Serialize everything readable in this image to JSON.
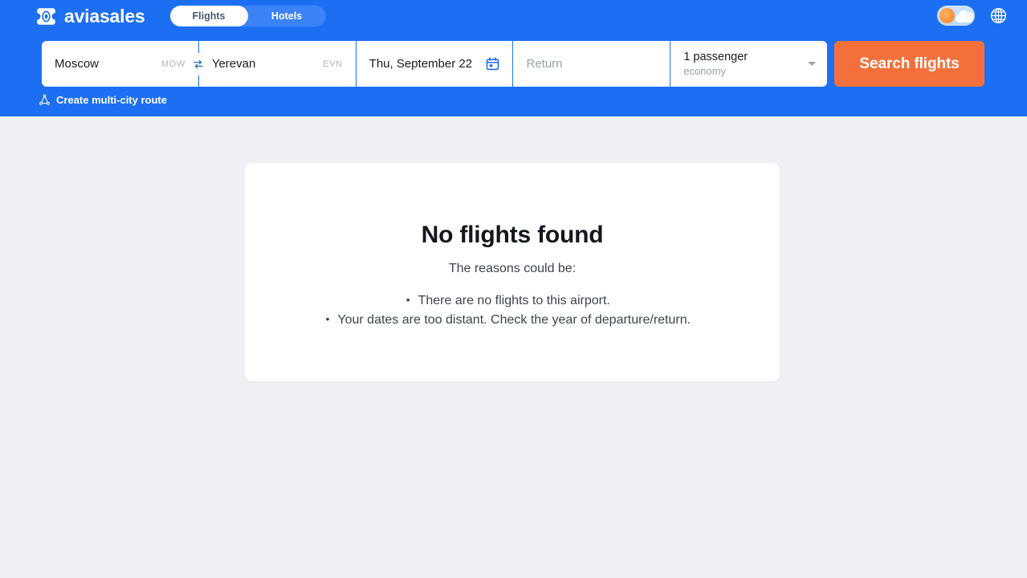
{
  "brand": {
    "name": "aviasales",
    "logo_icon": "aviasales-logo-icon"
  },
  "tabs": [
    {
      "label": "Flights",
      "active": true
    },
    {
      "label": "Hotels",
      "active": false
    }
  ],
  "topbar_right": {
    "theme_toggle_icon": "sun-cloud-toggle-icon",
    "language_icon": "globe-icon"
  },
  "search_form": {
    "origin": {
      "value": "Moscow",
      "code": "MOW"
    },
    "destination": {
      "value": "Yerevan",
      "code": "EVN"
    },
    "swap_icon": "swap-arrows-icon",
    "depart": {
      "value": "Thu, September 22",
      "icon": "calendar-icon"
    },
    "return": {
      "placeholder": "Return",
      "value": ""
    },
    "passengers": {
      "count_label": "1 passenger",
      "class_label": "economy",
      "caret_icon": "chevron-down-icon"
    },
    "submit_label": "Search flights"
  },
  "multicity": {
    "label": "Create multi-city route",
    "icon": "route-triangle-icon"
  },
  "result": {
    "title": "No flights found",
    "subtitle": "The reasons could be:",
    "reasons": [
      "There are no flights to this airport.",
      "Your dates are too distant. Check the year of departure/return."
    ]
  },
  "colors": {
    "brand_blue": "#1c6ff3",
    "accent_orange": "#f4703a",
    "page_bg": "#eef0f4",
    "card_bg": "#ffffff",
    "tab_track": "#3b83f6"
  }
}
